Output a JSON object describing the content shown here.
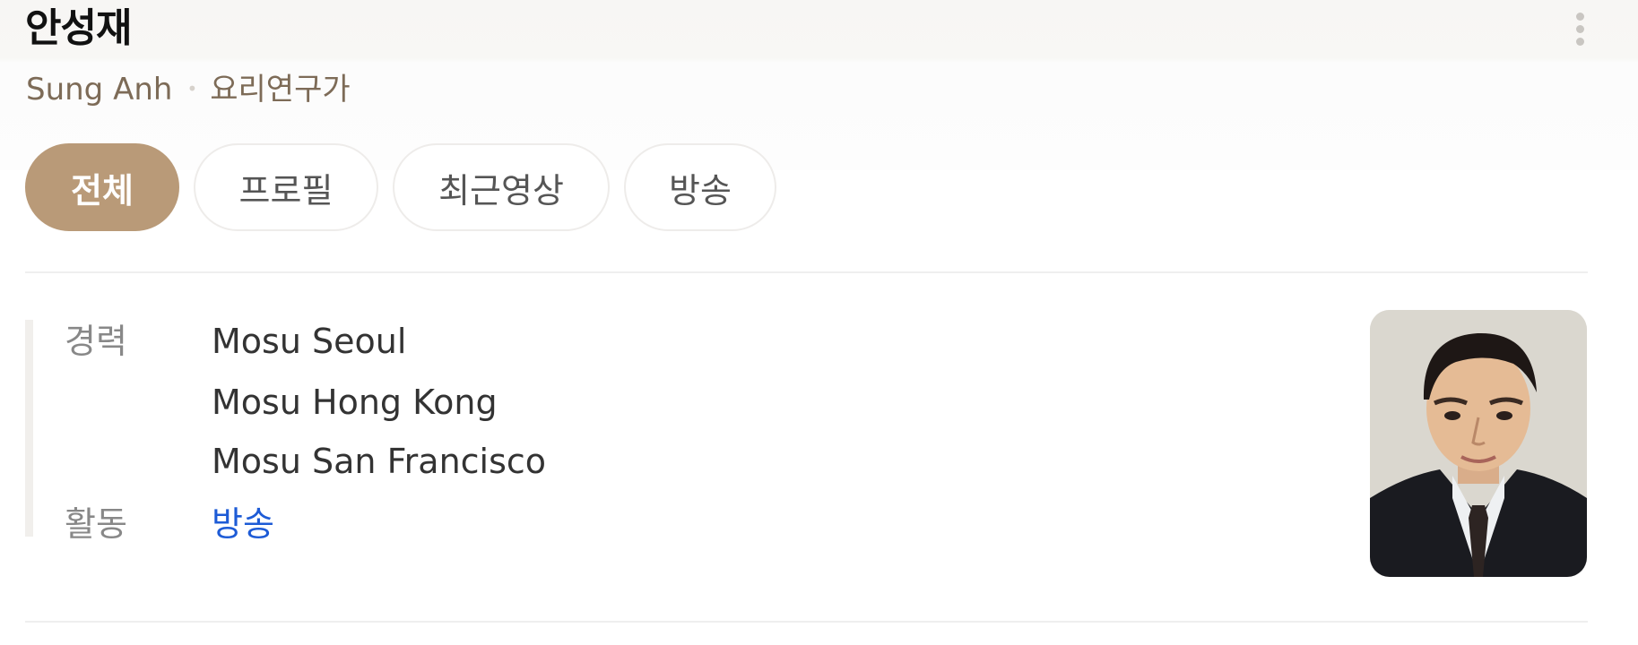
{
  "profile": {
    "name": "안성재",
    "english_name": "Sung Anh",
    "job": "요리연구가"
  },
  "tabs": [
    {
      "label": "전체",
      "active": true
    },
    {
      "label": "프로필",
      "active": false
    },
    {
      "label": "최근영상",
      "active": false
    },
    {
      "label": "방송",
      "active": false
    }
  ],
  "info": {
    "career_label": "경력",
    "career": [
      "Mosu Seoul",
      "Mosu Hong Kong",
      "Mosu San Francisco"
    ],
    "activity_label": "활동",
    "activity_value": "방송"
  },
  "icons": {
    "more": "more-vertical-icon",
    "photo": "profile-photo"
  },
  "colors": {
    "accent": "#b99a78",
    "link": "#1d5bd6",
    "subtitle": "#7d6b57"
  }
}
